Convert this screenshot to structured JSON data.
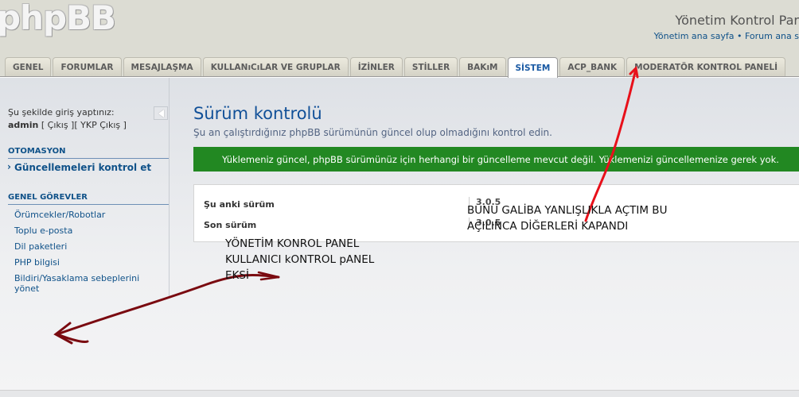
{
  "header": {
    "logo_text": "phpBB",
    "title": "Yönetim Kontrol Par",
    "links": "Yönetim ana sayfa • Forum ana s"
  },
  "tabs": [
    {
      "label": "GENEL"
    },
    {
      "label": "FORUMLAR"
    },
    {
      "label": "MESAJLAŞMA"
    },
    {
      "label": "KULLANıCıLAR VE GRUPLAR"
    },
    {
      "label": "İZİNLER"
    },
    {
      "label": "STİLLER"
    },
    {
      "label": "BAKıM"
    },
    {
      "label": "SİSTEM"
    },
    {
      "label": "ACP_BANK"
    },
    {
      "label": "MODERATÖR KONTROL PANELİ"
    }
  ],
  "active_tab": "SİSTEM",
  "sidebar": {
    "login_text": "Şu şekilde giriş yaptınız:",
    "username": "admin",
    "logout_link": "[ Çıkış ]",
    "ykp_logout_link": "[ YKP Çıkış ]",
    "section1_title": "OTOMASYON",
    "section1_items": [
      "Güncellemeleri kontrol et"
    ],
    "section2_title": "GENEL GÖREVLER",
    "section2_items": [
      "Örümcekler/Robotlar",
      "Toplu e-posta",
      "Dil paketleri",
      "PHP bilgisi",
      "Bildiri/Yasaklama sebeplerini yönet"
    ]
  },
  "main": {
    "title": "Sürüm kontrolü",
    "description": "Şu an çalıştırdığınız phpBB sürümünün güncel olup olmadığını kontrol edin.",
    "success_message": "Yüklemeniz güncel, phpBB sürümünüz için herhangi bir güncelleme mevcut değil. Yüklemenizi güncellemenize gerek yok.",
    "current_version_label": "Şu anki sürüm",
    "current_version_value": "3.0.5",
    "latest_version_label": "Son sürüm",
    "latest_version_value": "3.0.5"
  },
  "annotations": {
    "note_right_line1": "BUNU GALİBA YANLIŞLIKLA AÇTIM BU",
    "note_right_line2": "AÇILINCA DİĞERLERİ KAPANDI",
    "note_left_line1": "YÖNETİM KONROL PANEL",
    "note_left_line2": "KULLANICI kONTROL pANEL",
    "note_left_line3": "EKSİ",
    "red_arrow_color": "#e8101a",
    "dark_arrow_color": "#7a0a10"
  },
  "colors": {
    "accent": "#105289",
    "success": "#228822",
    "header_bg": "#dcdcd3"
  }
}
